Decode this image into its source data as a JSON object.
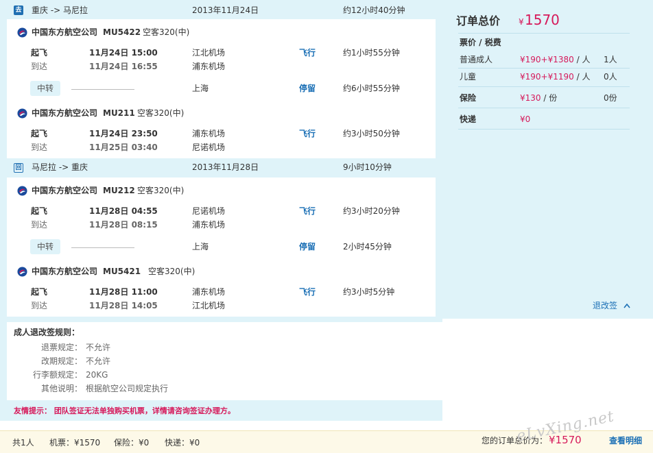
{
  "outbound": {
    "badge": "去",
    "route": "重庆 -> 马尼拉",
    "date": "2013年11月24日",
    "total_duration": "约12小时40分钟",
    "flights": [
      {
        "airline": "中国东方航空公司",
        "flight_no": "MU5422",
        "aircraft": "空客320(中)",
        "dep_label": "起飞",
        "dep_time": "11月24日  15:00",
        "dep_airport": "江北机场",
        "arr_label": "到达",
        "arr_time": "11月24日  16:55",
        "arr_airport": "浦东机场",
        "action": "飞行",
        "duration": "约1小时55分钟"
      },
      {
        "airline": "中国东方航空公司",
        "flight_no": "MU211",
        "aircraft": "空客320(中)",
        "dep_label": "起飞",
        "dep_time": "11月24日  23:50",
        "dep_airport": "浦东机场",
        "arr_label": "到达",
        "arr_time": "11月25日  03:40",
        "arr_airport": "尼诺机场",
        "action": "飞行",
        "duration": "约3小时50分钟"
      }
    ],
    "transfer": {
      "label": "中转",
      "city": "上海",
      "action": "停留",
      "duration": "约6小时55分钟"
    }
  },
  "return": {
    "badge": "回",
    "route": "马尼拉 -> 重庆",
    "date": "2013年11月28日",
    "total_duration": "9小时10分钟",
    "flights": [
      {
        "airline": "中国东方航空公司",
        "flight_no": "MU212",
        "aircraft": "空客320(中)",
        "dep_label": "起飞",
        "dep_time": "11月28日  04:55",
        "dep_airport": "尼诺机场",
        "arr_label": "到达",
        "arr_time": "11月28日  08:15",
        "arr_airport": "浦东机场",
        "action": "飞行",
        "duration": "约3小时20分钟"
      },
      {
        "airline": "中国东方航空公司",
        "flight_no": "MU5421",
        "aircraft": "空客320(中)",
        "dep_label": "起飞",
        "dep_time": "11月28日  11:00",
        "dep_airport": "浦东机场",
        "arr_label": "到达",
        "arr_time": "11月28日  14:05",
        "arr_airport": "江北机场",
        "action": "飞行",
        "duration": "约3小时5分钟"
      }
    ],
    "transfer": {
      "label": "中转",
      "city": "上海",
      "action": "停留",
      "duration": "2小时45分钟"
    }
  },
  "change_rules_link": "退改签",
  "rules": {
    "title": "成人退改签规则：",
    "items": [
      {
        "label": "退票规定：",
        "value": "不允许"
      },
      {
        "label": "改期规定：",
        "value": "不允许"
      },
      {
        "label": "行李额规定：",
        "value": "20KG"
      },
      {
        "label": "其他说明：",
        "value": "根据航空公司规定执行"
      }
    ]
  },
  "notice": "友情提示：  团队签证无法单独购买机票，详情请咨询签证办理方。",
  "order": {
    "title": "订单总价",
    "currency": "¥",
    "total": "1570",
    "header": "票价 / 税费",
    "rows": [
      {
        "label": "普通成人",
        "price": "¥190+¥1380",
        "unit": " / 人",
        "qty": "1人"
      },
      {
        "label": "儿童",
        "price": "¥190+¥1190",
        "unit": " / 人",
        "qty": "0人"
      },
      {
        "label": "保险",
        "price": "¥130",
        "unit": " / 份",
        "qty": "0份"
      },
      {
        "label": "快递",
        "price": "¥0",
        "unit": "",
        "qty": ""
      }
    ]
  },
  "footer": {
    "people": "共1人",
    "ticket": "机票：¥1570",
    "insurance": "保险：¥0",
    "delivery": "快递：¥0",
    "total_label": "您的订单总价为：",
    "total_value": "¥1570",
    "detail_link": "查看明细"
  },
  "colors": {
    "accent_blue": "#1a6fb5",
    "price_pink": "#d6195a",
    "panel_bg": "#dff3f9",
    "footer_bg": "#fdf9e8"
  },
  "watermark": "eLvXing.net"
}
